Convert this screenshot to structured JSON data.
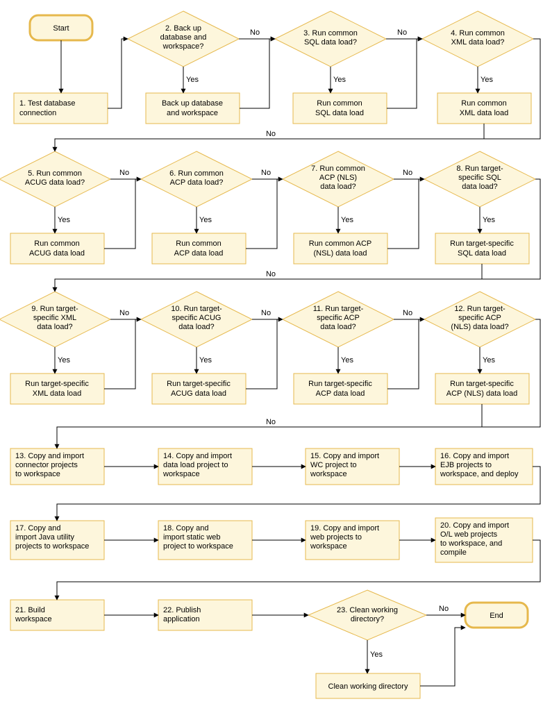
{
  "labels": {
    "start": "Start",
    "end": "End",
    "yes": "Yes",
    "no": "No"
  },
  "nodes": {
    "n1": {
      "lines": [
        "1. Test database",
        "connection"
      ]
    },
    "q2": {
      "lines": [
        "2. Back up",
        "database and",
        "workspace?"
      ]
    },
    "a2": {
      "lines": [
        "Back up database",
        "and workspace"
      ]
    },
    "q3": {
      "lines": [
        "3. Run common",
        "SQL data load?"
      ]
    },
    "a3": {
      "lines": [
        "Run common",
        "SQL data load"
      ]
    },
    "q4": {
      "lines": [
        "4. Run common",
        "XML data load?"
      ]
    },
    "a4": {
      "lines": [
        "Run common",
        "XML data load"
      ]
    },
    "q5": {
      "lines": [
        "5. Run common",
        "ACUG data load?"
      ]
    },
    "a5": {
      "lines": [
        "Run common",
        "ACUG data load"
      ]
    },
    "q6": {
      "lines": [
        "6. Run common",
        "ACP data load?"
      ]
    },
    "a6": {
      "lines": [
        "Run common",
        "ACP data load"
      ]
    },
    "q7": {
      "lines": [
        "7. Run common",
        "ACP (NLS)",
        "data load?"
      ]
    },
    "a7": {
      "lines": [
        "Run common ACP",
        "(NSL) data load"
      ]
    },
    "q8": {
      "lines": [
        "8. Run target-",
        "specific SQL",
        "data load?"
      ]
    },
    "a8": {
      "lines": [
        "Run target-specific",
        "SQL data load"
      ]
    },
    "q9": {
      "lines": [
        "9. Run target-",
        "specific XML",
        "data load?"
      ]
    },
    "a9": {
      "lines": [
        "Run target-specific",
        "XML data load"
      ]
    },
    "q10": {
      "lines": [
        "10. Run target-",
        "specific ACUG",
        "data load?"
      ]
    },
    "a10": {
      "lines": [
        "Run target-specific",
        "ACUG data load"
      ]
    },
    "q11": {
      "lines": [
        "11. Run target-",
        "specific ACP",
        "data load?"
      ]
    },
    "a11": {
      "lines": [
        "Run target-specific",
        "ACP data load"
      ]
    },
    "q12": {
      "lines": [
        "12. Run target-",
        "specific ACP",
        "(NLS) data load?"
      ]
    },
    "a12": {
      "lines": [
        "Run target-specific",
        "ACP (NLS) data load"
      ]
    },
    "n13": {
      "lines": [
        "13. Copy and import",
        "connector projects",
        "to workspace"
      ]
    },
    "n14": {
      "lines": [
        "14. Copy and import",
        "data load project to",
        "workspace"
      ]
    },
    "n15": {
      "lines": [
        "15. Copy and import",
        "WC project to",
        "workspace"
      ]
    },
    "n16": {
      "lines": [
        "16. Copy and import",
        "EJB projects to",
        "workspace, and deploy"
      ]
    },
    "n17": {
      "lines": [
        "17. Copy and",
        "import Java utility",
        "projects to workspace"
      ]
    },
    "n18": {
      "lines": [
        "18. Copy and",
        "import static web",
        "project to workspace"
      ]
    },
    "n19": {
      "lines": [
        "19. Copy and import",
        "web projects to",
        "workspace"
      ]
    },
    "n20": {
      "lines": [
        "20. Copy and import",
        "O/L web projects",
        "to workspace, and",
        "compile"
      ]
    },
    "n21": {
      "lines": [
        "21. Build",
        "workspace"
      ]
    },
    "n22": {
      "lines": [
        "22. Publish",
        "application"
      ]
    },
    "q23": {
      "lines": [
        "23. Clean working",
        "directory?"
      ]
    },
    "a23": {
      "lines": [
        "Clean working directory"
      ]
    }
  }
}
